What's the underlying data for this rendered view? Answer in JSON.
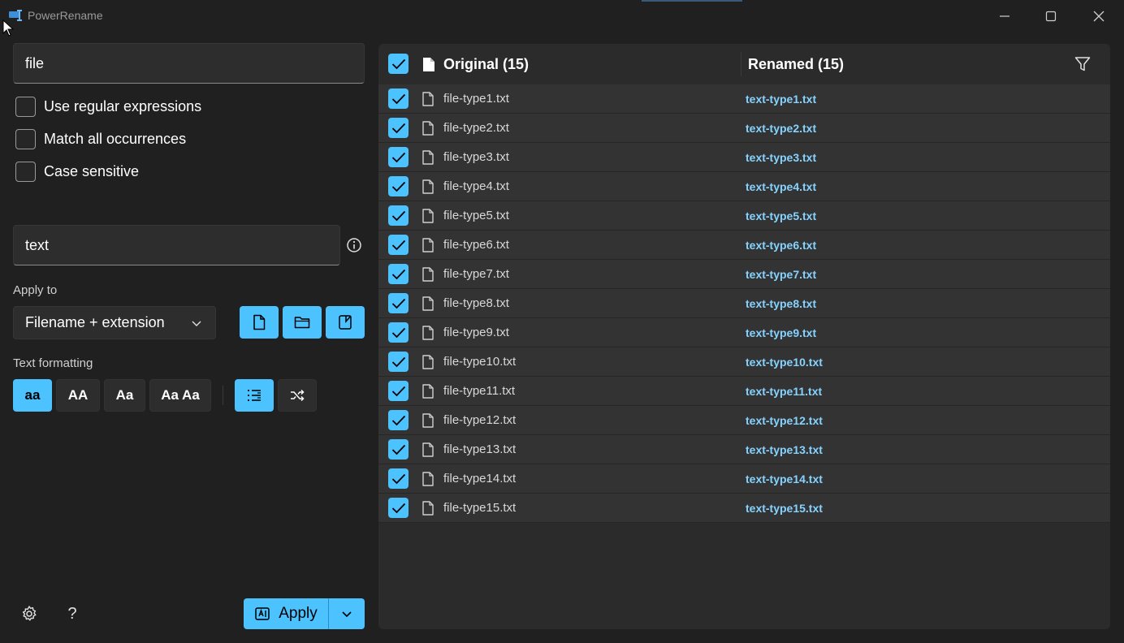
{
  "window": {
    "title": "PowerRename"
  },
  "search": {
    "value": "file"
  },
  "options": [
    {
      "label": "Use regular expressions"
    },
    {
      "label": "Match all occurrences"
    },
    {
      "label": "Case sensitive"
    }
  ],
  "replace": {
    "value": "text"
  },
  "apply_to": {
    "label": "Apply to",
    "selected": "Filename + extension"
  },
  "text_formatting": {
    "label": "Text formatting",
    "buttons": [
      "aa",
      "AA",
      "Aa",
      "Aa Aa"
    ]
  },
  "apply_button": {
    "label": "Apply"
  },
  "list": {
    "original_header": "Original (15)",
    "renamed_header": "Renamed (15)",
    "items": [
      {
        "original": "file-type1.txt",
        "renamed": "text-type1.txt"
      },
      {
        "original": "file-type2.txt",
        "renamed": "text-type2.txt"
      },
      {
        "original": "file-type3.txt",
        "renamed": "text-type3.txt"
      },
      {
        "original": "file-type4.txt",
        "renamed": "text-type4.txt"
      },
      {
        "original": "file-type5.txt",
        "renamed": "text-type5.txt"
      },
      {
        "original": "file-type6.txt",
        "renamed": "text-type6.txt"
      },
      {
        "original": "file-type7.txt",
        "renamed": "text-type7.txt"
      },
      {
        "original": "file-type8.txt",
        "renamed": "text-type8.txt"
      },
      {
        "original": "file-type9.txt",
        "renamed": "text-type9.txt"
      },
      {
        "original": "file-type10.txt",
        "renamed": "text-type10.txt"
      },
      {
        "original": "file-type11.txt",
        "renamed": "text-type11.txt"
      },
      {
        "original": "file-type12.txt",
        "renamed": "text-type12.txt"
      },
      {
        "original": "file-type13.txt",
        "renamed": "text-type13.txt"
      },
      {
        "original": "file-type14.txt",
        "renamed": "text-type14.txt"
      },
      {
        "original": "file-type15.txt",
        "renamed": "text-type15.txt"
      }
    ]
  },
  "colors": {
    "accent": "#4cc2ff",
    "renamed_text": "#86d3ff",
    "background": "#202020",
    "panel": "#2b2b2b"
  }
}
